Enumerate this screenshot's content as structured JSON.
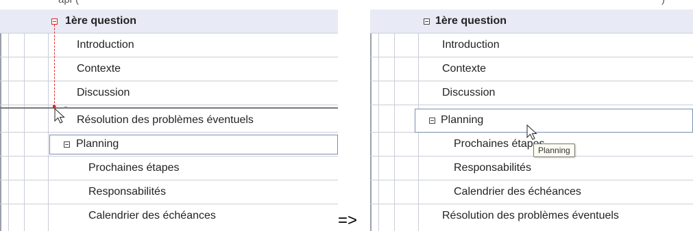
{
  "top_caption_fragments": [
    "apr",
    "(",
    ")"
  ],
  "arrow": "=>",
  "before": {
    "header": "1ère question",
    "items": [
      "Introduction",
      "Contexte",
      "Discussion",
      "Résolution des problèmes éventuels"
    ],
    "selected_heading": "Planning",
    "sub_items": [
      "Prochaines étapes",
      "Responsabilités",
      "Calendrier des échéances"
    ]
  },
  "after": {
    "header": "1ère question",
    "items": [
      "Introduction",
      "Contexte",
      "Discussion"
    ],
    "selected_heading": "Planning",
    "sub_items": [
      "Prochaines étapes",
      "Responsabilités",
      "Calendrier des échéances"
    ],
    "trailing_item": "Résolution des problèmes éventuels",
    "tooltip": "Planning"
  },
  "icons": {
    "collapse": "collapse-toggle-icon",
    "cursor": "mouse-pointer-icon",
    "drag_guide": "drag-guide-icon"
  },
  "colors": {
    "drag_red": "#e02020",
    "header_bg": "#e8ebf5",
    "selection_border": "#7b8cb0"
  }
}
